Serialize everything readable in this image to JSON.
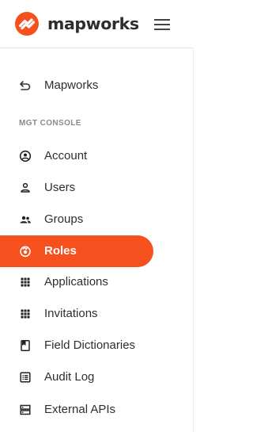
{
  "brand": {
    "name": "mapworks",
    "accent_color": "#f6501e"
  },
  "header": {
    "menu_icon": "hamburger-menu-icon"
  },
  "back_link": {
    "label": "Mapworks",
    "icon": "back-arrow-icon"
  },
  "section": {
    "label": "MGT CONSOLE"
  },
  "nav": {
    "items": [
      {
        "label": "Account",
        "icon": "account-circle-icon",
        "active": false
      },
      {
        "label": "Users",
        "icon": "user-icon",
        "active": false
      },
      {
        "label": "Groups",
        "icon": "group-icon",
        "active": false
      },
      {
        "label": "Roles",
        "icon": "roles-icon",
        "active": true
      },
      {
        "label": "Applications",
        "icon": "apps-grid-icon",
        "active": false
      },
      {
        "label": "Invitations",
        "icon": "apps-grid-icon",
        "active": false
      },
      {
        "label": "Field Dictionaries",
        "icon": "bookmark-book-icon",
        "active": false
      },
      {
        "label": "Audit Log",
        "icon": "list-log-icon",
        "active": false
      },
      {
        "label": "External APIs",
        "icon": "storage-icon",
        "active": false
      }
    ]
  }
}
